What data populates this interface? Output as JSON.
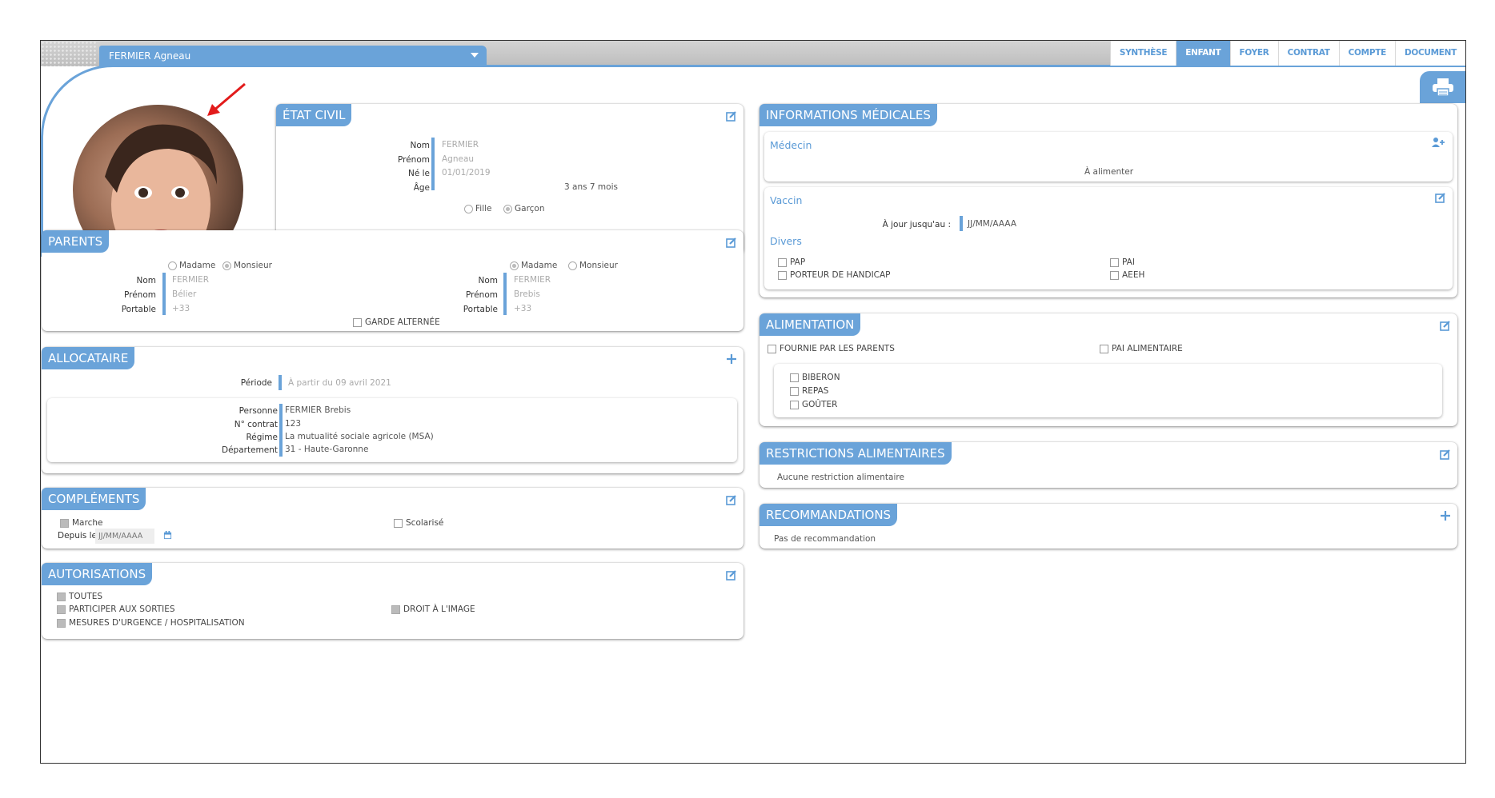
{
  "header": {
    "child_name": "FERMIER Agneau",
    "tabs": [
      "SYNTHÈSE",
      "ENFANT",
      "FOYER",
      "CONTRAT",
      "COMPTE",
      "DOCUMENT"
    ],
    "active_tab": "ENFANT",
    "print_icon": "printer-icon"
  },
  "etat_civil": {
    "title": "ÉTAT CIVIL",
    "nom_label": "Nom",
    "nom": "FERMIER",
    "prenom_label": "Prénom",
    "prenom": "Agneau",
    "ne_le_label": "Né le",
    "ne_le": "01/01/2019",
    "age_label": "Âge",
    "age": "3 ans 7 mois",
    "fille": "Fille",
    "garcon": "Garçon",
    "edit_icon": "edit-icon"
  },
  "parents": {
    "title": "PARENTS",
    "p1": {
      "madame": "Madame",
      "monsieur": "Monsieur",
      "nom_label": "Nom",
      "nom": "FERMIER",
      "prenom_label": "Prénom",
      "prenom": "Bélier",
      "portable_label": "Portable",
      "portable": "+33"
    },
    "p2": {
      "madame": "Madame",
      "monsieur": "Monsieur",
      "nom_label": "Nom",
      "nom": "FERMIER",
      "prenom_label": "Prénom",
      "prenom": "Brebis",
      "portable_label": "Portable",
      "portable": "+33"
    },
    "garde": "GARDE ALTERNÉE"
  },
  "allocataire": {
    "title": "ALLOCATAIRE",
    "periode_label": "Période",
    "periode": "À partir du 09 avril 2021",
    "personne_label": "Personne",
    "personne": "FERMIER Brebis",
    "contrat_label": "N° contrat",
    "contrat": "123",
    "regime_label": "Régime",
    "regime": "La mutualité sociale agricole (MSA)",
    "dept_label": "Département",
    "dept": "31 - Haute-Garonne",
    "add_icon": "plus-icon"
  },
  "complements": {
    "title": "COMPLÉMENTS",
    "marche": "Marche",
    "scolarise": "Scolarisé",
    "depuis_label": "Depuis le",
    "date_placeholder": "JJ/MM/AAAA",
    "calendar_icon": "calendar-icon"
  },
  "autorisations": {
    "title": "AUTORISATIONS",
    "toutes": "TOUTES",
    "sorties": "PARTICIPER AUX SORTIES",
    "urgence": "MESURES D'URGENCE / HOSPITALISATION",
    "image": "DROIT À L'IMAGE"
  },
  "medical": {
    "title": "INFORMATIONS MÉDICALES",
    "medecin": "Médecin",
    "a_alimenter": "À alimenter",
    "vaccin": "Vaccin",
    "a_jour_label": "À jour jusqu'au :",
    "a_jour": "JJ/MM/AAAA",
    "divers": "Divers",
    "pap": "PAP",
    "handicap": "PORTEUR DE HANDICAP",
    "pai": "PAI",
    "aeeh": "AEEH",
    "add_person_icon": "add-person-icon"
  },
  "alimentation": {
    "title": "ALIMENTATION",
    "fournie": "FOURNIE PAR LES PARENTS",
    "pai_alim": "PAI ALIMENTAIRE",
    "biberon": "BIBERON",
    "repas": "REPAS",
    "gouter": "GOÛTER"
  },
  "restrictions": {
    "title": "RESTRICTIONS ALIMENTAIRES",
    "text": "Aucune restriction alimentaire"
  },
  "recommandations": {
    "title": "RECOMMANDATIONS",
    "text": "Pas de recommandation"
  },
  "colors": {
    "accent": "#6aa3d9"
  }
}
